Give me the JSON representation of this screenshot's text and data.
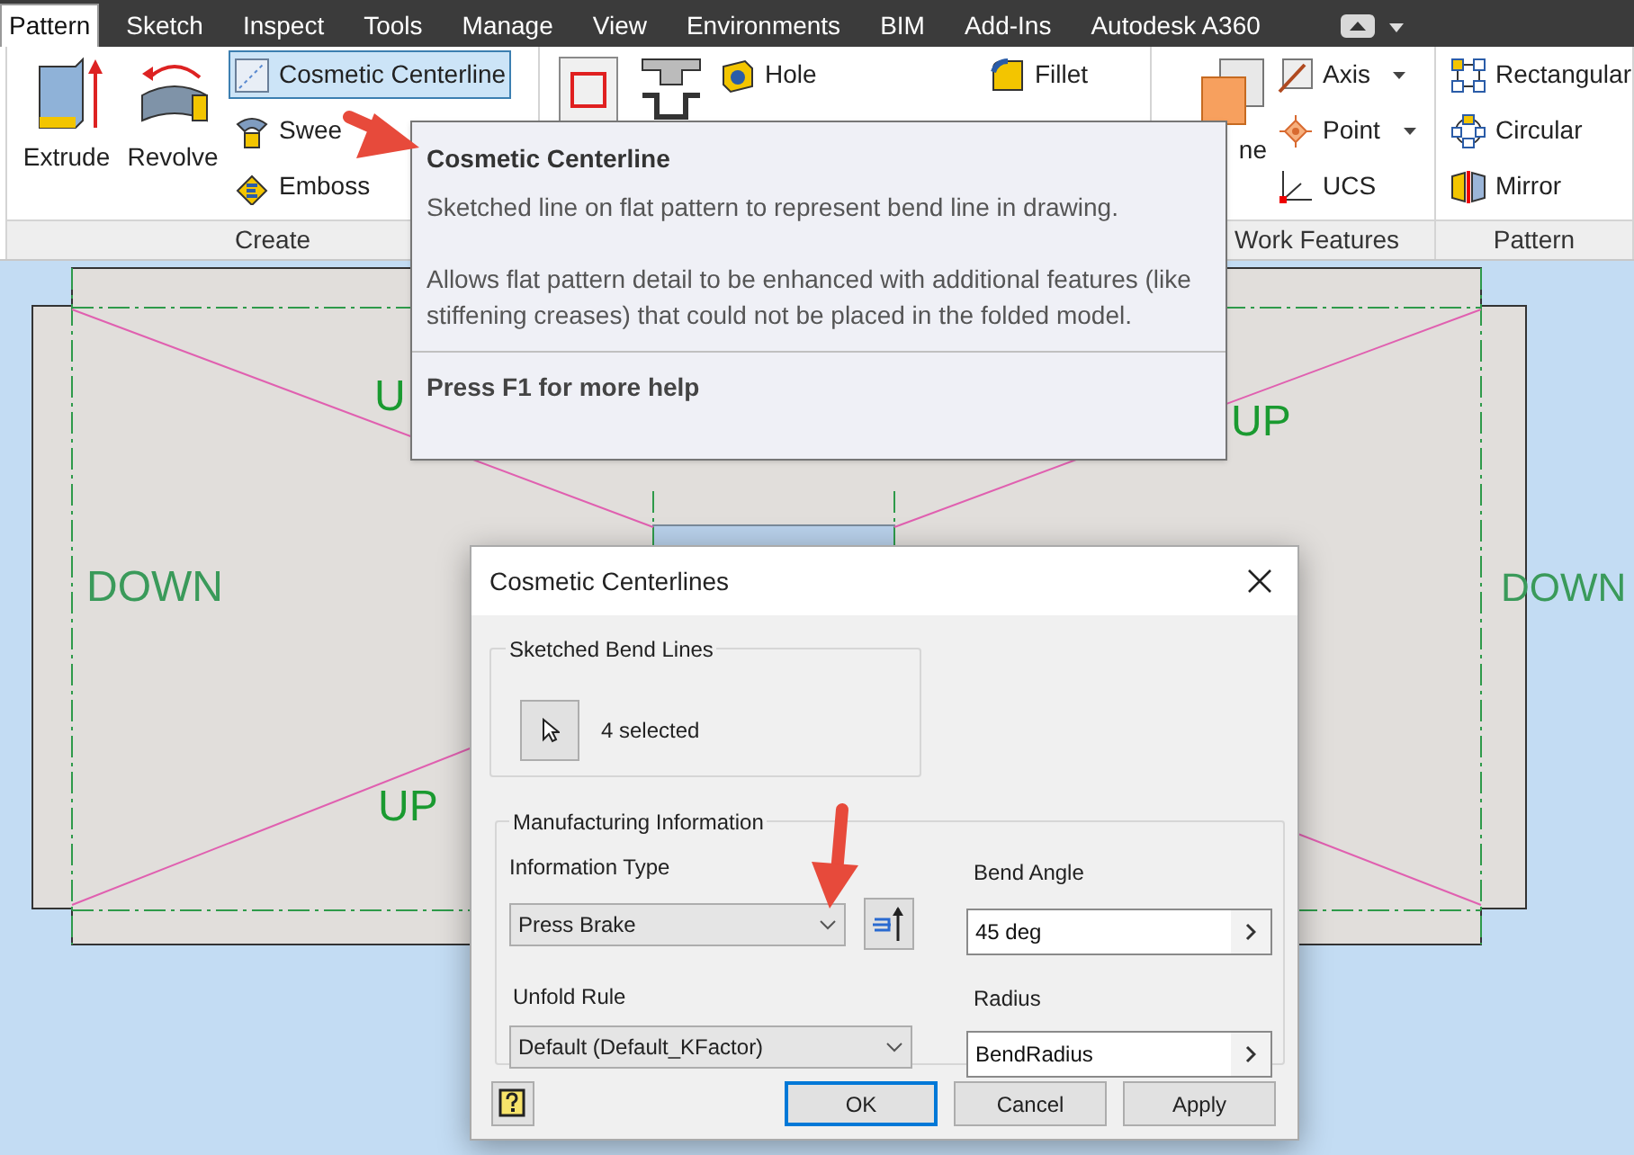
{
  "tabs": [
    {
      "label": "Pattern",
      "selected": true
    },
    {
      "label": "Sketch",
      "selected": false
    },
    {
      "label": "Inspect",
      "selected": false
    },
    {
      "label": "Tools",
      "selected": false
    },
    {
      "label": "Manage",
      "selected": false
    },
    {
      "label": "View",
      "selected": false
    },
    {
      "label": "Environments",
      "selected": false
    },
    {
      "label": "BIM",
      "selected": false
    },
    {
      "label": "Add-Ins",
      "selected": false
    },
    {
      "label": "Autodesk A360",
      "selected": false
    }
  ],
  "ribbon": {
    "panels": [
      {
        "title": "Create",
        "columns": [
          [
            {
              "kind": "large",
              "label": "Extrude",
              "selected": false
            }
          ],
          [
            {
              "kind": "large",
              "label": "Revolve",
              "selected": false
            }
          ],
          [
            {
              "kind": "small",
              "label": "Cosmetic Centerline",
              "selected": true
            },
            {
              "kind": "small",
              "label": "Swee",
              "selected": false
            },
            {
              "kind": "small",
              "label": "Emboss",
              "selected": false
            }
          ]
        ]
      },
      {
        "columns": [
          [
            {
              "kind": "icon",
              "selected": false
            }
          ],
          [
            {
              "kind": "icon",
              "selected": false
            }
          ],
          [
            {
              "kind": "small",
              "label": "Hole",
              "selected": false
            }
          ],
          [
            {
              "kind": "small",
              "label": "Fillet",
              "selected": false
            }
          ]
        ]
      },
      {
        "title": "Work Features",
        "columns": [
          [
            {
              "kind": "large",
              "label": "ne",
              "selected": false
            }
          ],
          [
            {
              "kind": "dropdown",
              "label": "Axis",
              "selected": false
            },
            {
              "kind": "dropdown",
              "label": "Point",
              "selected": false
            },
            {
              "kind": "small",
              "label": "UCS",
              "selected": false
            }
          ]
        ]
      },
      {
        "title": "Pattern",
        "columns": [
          [
            {
              "kind": "small",
              "label": "Rectangular",
              "selected": false
            },
            {
              "kind": "small",
              "label": "Circular",
              "selected": false
            },
            {
              "kind": "small",
              "label": "Mirror",
              "selected": false
            }
          ]
        ]
      }
    ]
  },
  "tooltip": {
    "title": "Cosmetic Centerline",
    "paragraphs": [
      "Sketched line on flat pattern to represent bend line in drawing.",
      "Allows flat pattern detail to be enhanced with additional features (like stiffening creases) that could not be placed in the folded model."
    ],
    "footer": "Press F1 for more help"
  },
  "canvas": {
    "labels": [
      {
        "text": "U"
      },
      {
        "text": "UP"
      },
      {
        "text": "DOWN"
      },
      {
        "text": "DOWN"
      },
      {
        "text": "UP"
      }
    ]
  },
  "dialog": {
    "title": "Cosmetic Centerlines",
    "sketched_bend_lines": {
      "title": "Sketched Bend Lines",
      "selection": "4 selected"
    },
    "manufacturing": {
      "title": "Manufacturing Information",
      "information_type": {
        "label": "Information Type",
        "value": "Press Brake"
      },
      "unfold_rule": {
        "label": "Unfold Rule",
        "value": "Default (Default_KFactor)"
      },
      "bend_angle": {
        "label": "Bend Angle",
        "value": "45 deg"
      },
      "radius": {
        "label": "Radius",
        "value": "BendRadius"
      }
    },
    "buttons": [
      {
        "label": "OK",
        "default": true
      },
      {
        "label": "Cancel",
        "default": false
      },
      {
        "label": "Apply",
        "default": false
      }
    ]
  }
}
